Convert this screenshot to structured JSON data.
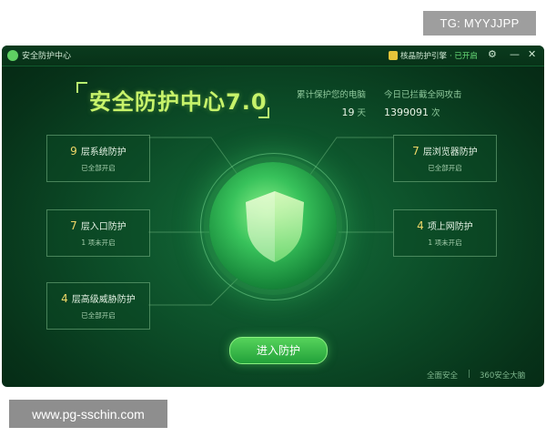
{
  "watermarks": {
    "top": "TG: MYYJJPP",
    "bottom": "www.pg-sschin.com"
  },
  "window": {
    "title": "安全防护中心",
    "engine_label": "核晶防护引擎",
    "engine_status": "· 已开启"
  },
  "main_title": "安全防护中心7.0",
  "stats": {
    "protected_label": "累计保护您的电脑",
    "protected_value": "19",
    "protected_unit": "天",
    "blocked_label": "今日已拦截全网攻击",
    "blocked_value": "1399091",
    "blocked_unit": "次"
  },
  "boxes": [
    {
      "num": "9",
      "title": "层系统防护",
      "sub": "已全部开启"
    },
    {
      "num": "7",
      "title": "层入口防护",
      "sub": "1 项未开启"
    },
    {
      "num": "4",
      "title": "层高级威胁防护",
      "sub": "已全部开启"
    },
    {
      "num": "7",
      "title": "层浏览器防护",
      "sub": "已全部开启"
    },
    {
      "num": "4",
      "title": "项上网防护",
      "sub": "1 项未开启"
    }
  ],
  "enter_button": "进入防护",
  "footer": {
    "left": "全面安全",
    "sep": "|",
    "right": "360安全大脑"
  },
  "colors": {
    "accent": "#c7f36a",
    "button": "#3cbd4a",
    "bg": "#0c4d28"
  }
}
